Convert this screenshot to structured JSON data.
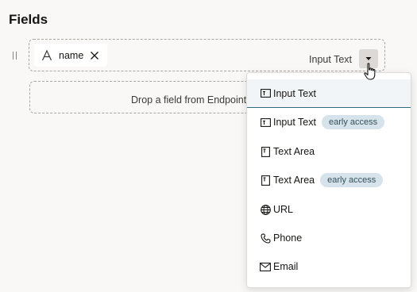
{
  "heading": "Fields",
  "field": {
    "name": "name",
    "type_label": "Input Text"
  },
  "drop_zone": {
    "text": "Drop a field from Endpoint"
  },
  "menu": {
    "items": [
      {
        "label": "Input Text",
        "icon": "input-text-icon",
        "selected": true
      },
      {
        "label": "Input Text",
        "icon": "input-text-icon",
        "badge": "early access"
      },
      {
        "label": "Text Area",
        "icon": "text-area-icon"
      },
      {
        "label": "Text Area",
        "icon": "text-area-icon",
        "badge": "early access"
      },
      {
        "label": "URL",
        "icon": "globe-icon"
      },
      {
        "label": "Phone",
        "icon": "phone-icon"
      },
      {
        "label": "Email",
        "icon": "envelope-icon"
      }
    ]
  },
  "colors": {
    "selected_underline": "#2e6b7d",
    "badge_bg": "#d6e3ea",
    "page_bg": "#f9f8f6"
  }
}
